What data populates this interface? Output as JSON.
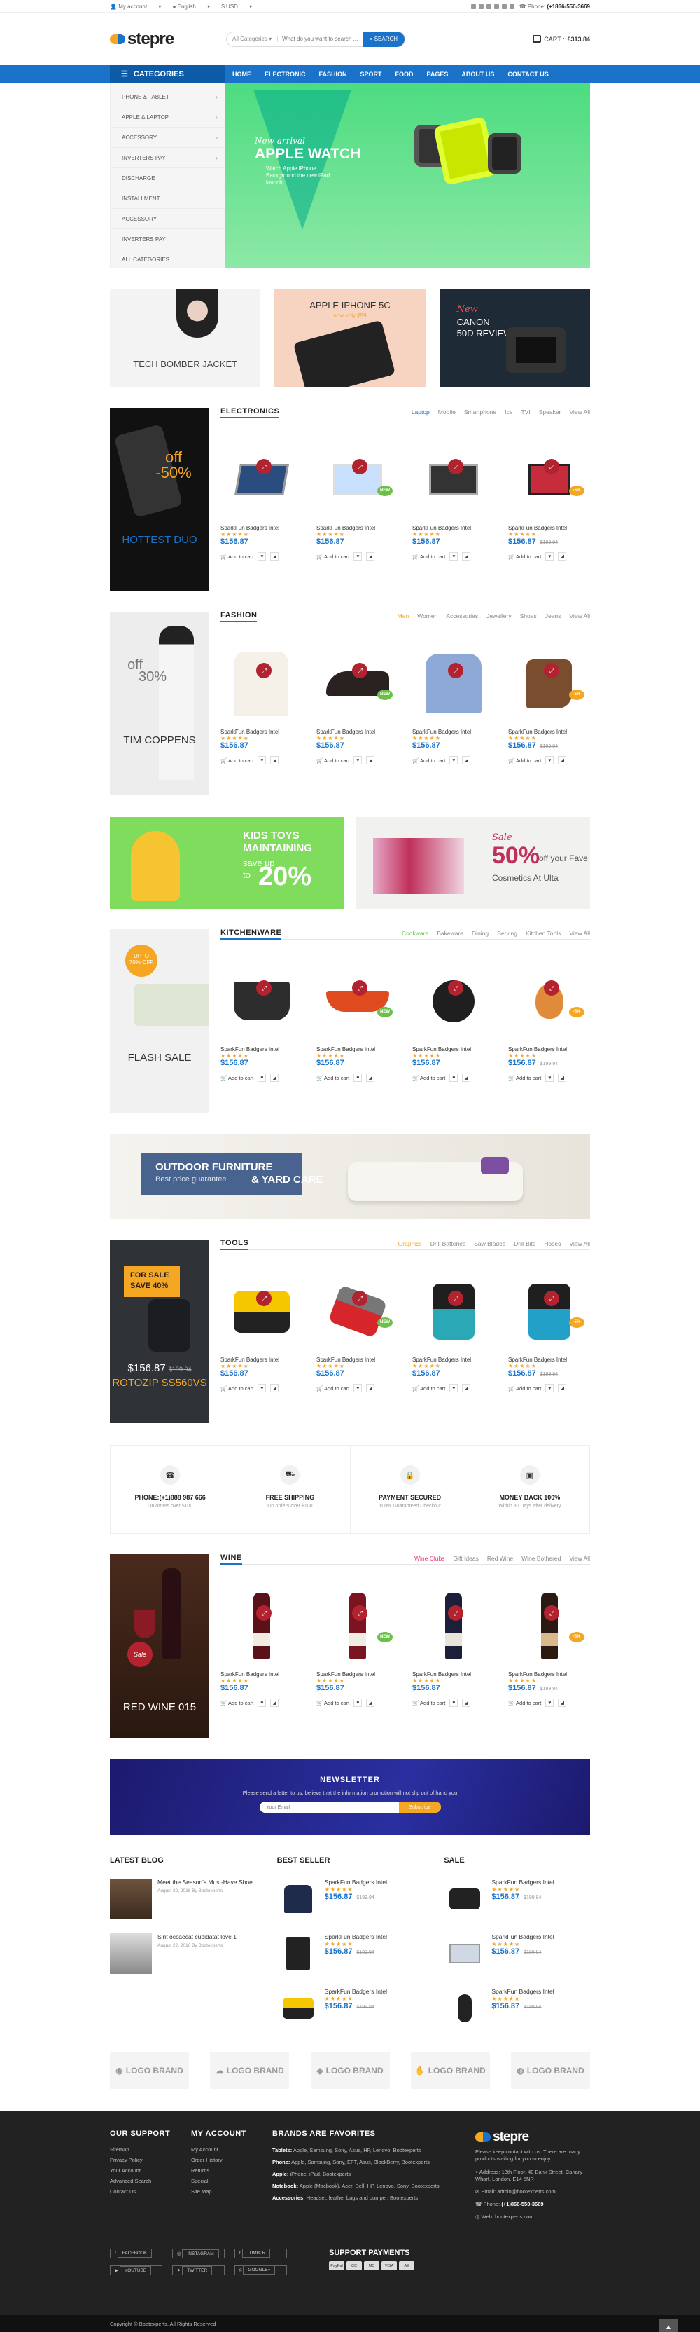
{
  "topbar": {
    "account": "My account",
    "language": "English",
    "currency": "USD",
    "phone_label": "Phone:",
    "phone": "(+1866-550-3669"
  },
  "header": {
    "logo": "stepre",
    "search_category": "All Categories",
    "search_placeholder": "What do you want to search ...",
    "search_button": "SEARCH",
    "cart_label": "CART :",
    "cart_total": "£313.84"
  },
  "nav": {
    "categories_label": "CATEGORIES",
    "links": [
      "HOME",
      "ELECTRONIC",
      "FASHION",
      "SPORT",
      "FOOD",
      "PAGES",
      "ABOUT US",
      "CONTACT US"
    ]
  },
  "sidebar_categories": [
    "PHONE & TABLET",
    "APPLE & LAPTOP",
    "ACCESSORY",
    "INVERTERS PAY",
    "DISCHARGE",
    "INSTALLMENT",
    "ACCESSORY",
    "INVERTERS PAY",
    "ALL CATEGORIES"
  ],
  "hero": {
    "line1": "New arrival",
    "line2": "APPLE WATCH",
    "line3": "Watch Apple iPhone Background the new iPad launch"
  },
  "promos": [
    {
      "title": "TECH BOMBER JACKET"
    },
    {
      "title": "APPLE IPHONE 5C",
      "sub": "now only $99"
    },
    {
      "line1": "New",
      "line2": "CANON",
      "line3": "50D REVIEW"
    }
  ],
  "sections": {
    "electronics": {
      "title": "ELECTRONICS",
      "tabs": [
        "Laptop",
        "Mobile",
        "Smartphone",
        "Ice",
        "TVI",
        "Speaker",
        "View All"
      ],
      "banner": {
        "off": "off",
        "pct": "-50%",
        "title": "HOTTEST DUO"
      }
    },
    "fashion": {
      "title": "FASHION",
      "tabs": [
        "Men",
        "Women",
        "Accessories",
        "Jewellery",
        "Shoes",
        "Jeans",
        "View All"
      ],
      "banner": {
        "off": "off",
        "pct": "30%",
        "title": "TIM COPPENS"
      }
    },
    "kitchenware": {
      "title": "KITCHENWARE",
      "tabs": [
        "Cookware",
        "Bakeware",
        "Dining",
        "Serving",
        "Kitchen Tools",
        "View All"
      ],
      "banner": {
        "badge1": "UPTO",
        "badge2": "70% OFF",
        "title": "FLASH SALE"
      }
    },
    "tools": {
      "title": "TOOLS",
      "tabs": [
        "Graphics",
        "Drill Batteries",
        "Saw Blades",
        "Drill Bits",
        "Hoses",
        "View All"
      ],
      "banner": {
        "l1": "FOR SALE",
        "l2": "SAVE 40%",
        "price": "$156.87",
        "old": "$199.94",
        "title": "ROTOZIP SS560VS"
      }
    },
    "wine": {
      "title": "WINE",
      "tabs": [
        "Wine Clubs",
        "Gift Ideas",
        "Red Wine",
        "Wine Bothered",
        "View All"
      ],
      "banner": {
        "sale": "Sale",
        "title": "RED WINE 015"
      }
    }
  },
  "product": {
    "name": "SparkFun Badgers Intel",
    "stars": "★★★★★",
    "price": "$156.87",
    "old": "$199.94",
    "add": "Add to cart",
    "new": "NEW",
    "off": "-5%"
  },
  "banners": {
    "kids": {
      "l1": "KIDS TOYS",
      "l2": "MAINTAINING",
      "l3": "save up",
      "l4": "to",
      "l5": "20%"
    },
    "cosmetics": {
      "l1": "Sale",
      "l2": "50%",
      "l3": "off your Fave",
      "l4": "Cosmetics At Ulta"
    },
    "furniture": {
      "l1": "OUTDOOR FURNITURE",
      "l2": "Best price guarantee",
      "l3": "& YARD CARE"
    }
  },
  "services": [
    {
      "icon": "phone-icon",
      "title": "PHONE:(+1)888 987 666",
      "sub": "On orders over $100"
    },
    {
      "icon": "truck-icon",
      "title": "FREE SHIPPING",
      "sub": "On orders over $100"
    },
    {
      "icon": "lock-icon",
      "title": "PAYMENT SECURED",
      "sub": "100% Guaranteed Checkout"
    },
    {
      "icon": "money-icon",
      "title": "MONEY BACK 100%",
      "sub": "Within 30 Days after delivery"
    }
  ],
  "newsletter": {
    "title": "NEWSLETTER",
    "text": "Please send a letter to us, believe that the information promotion will not slip out of hand you",
    "placeholder": "Your Email",
    "button": "Subscribe"
  },
  "latest_blog": {
    "title": "LATEST BLOG",
    "items": [
      {
        "title": "Meet the Season's Must-Have Shoe",
        "date": "August 22, 2016 By Bootexperts"
      },
      {
        "title": "Sint occaecat cupidatat love 1",
        "date": "August 22, 2016 By Bootexperts"
      }
    ]
  },
  "best_seller": {
    "title": "BEST SELLER"
  },
  "sale": {
    "title": "SALE"
  },
  "brands": [
    "LOGO BRAND",
    "LOGO BRAND",
    "LOGO BRAND",
    "LOGO BRAND",
    "LOGO BRAND"
  ],
  "footer": {
    "support": {
      "title": "OUR SUPPORT",
      "links": [
        "Sitemap",
        "Privacy Policy",
        "Your Account",
        "Advanced Search",
        "Contact Us"
      ]
    },
    "account": {
      "title": "MY ACCOUNT",
      "links": [
        "My Account",
        "Order History",
        "Returns",
        "Special",
        "Site Map"
      ]
    },
    "brands": {
      "title": "BRANDS ARE FAVORITES",
      "rows": [
        {
          "k": "Tablets:",
          "v": "Apple, Samsung, Sony, Asus, HP, Lenovo, Bootexperts"
        },
        {
          "k": "Phone:",
          "v": "Apple, Samsung, Sony, EFT, Asus, BlackBerry, Bootexperts"
        },
        {
          "k": "Apple:",
          "v": "iPhone, iPad, Bootexperts"
        },
        {
          "k": "Notebook:",
          "v": "Apple (Macbook), Acer, Dell, HP, Lenovo, Sony, Bootexperts"
        },
        {
          "k": "Accessories:",
          "v": "Headset, leather bags and bumper, Bootexperts"
        }
      ]
    },
    "contact": {
      "text": "Please keep contact with us. There are many products waiting for you to enjoy",
      "address": "Address: 13th Floor, 40 Bank Street, Canary Wharf, London, E14 5NR",
      "email": "Email: admin@bootexperts.com",
      "phone_label": "Phone:",
      "phone": "(+1)866-550-3669",
      "web": "Web: bootexperts.com"
    },
    "social": [
      "FACEBOOK",
      "INSTAGRAM",
      "TUMBLR",
      "YOUTUBE",
      "TWITTER",
      "GOOGLE+"
    ],
    "payment_title": "SUPPORT PAYMENTS",
    "cards": [
      "PayPal",
      "CC",
      "MC",
      "VISA",
      "AE"
    ],
    "copyright": "Copyright © Bootexperts. All Rights Reserved"
  }
}
